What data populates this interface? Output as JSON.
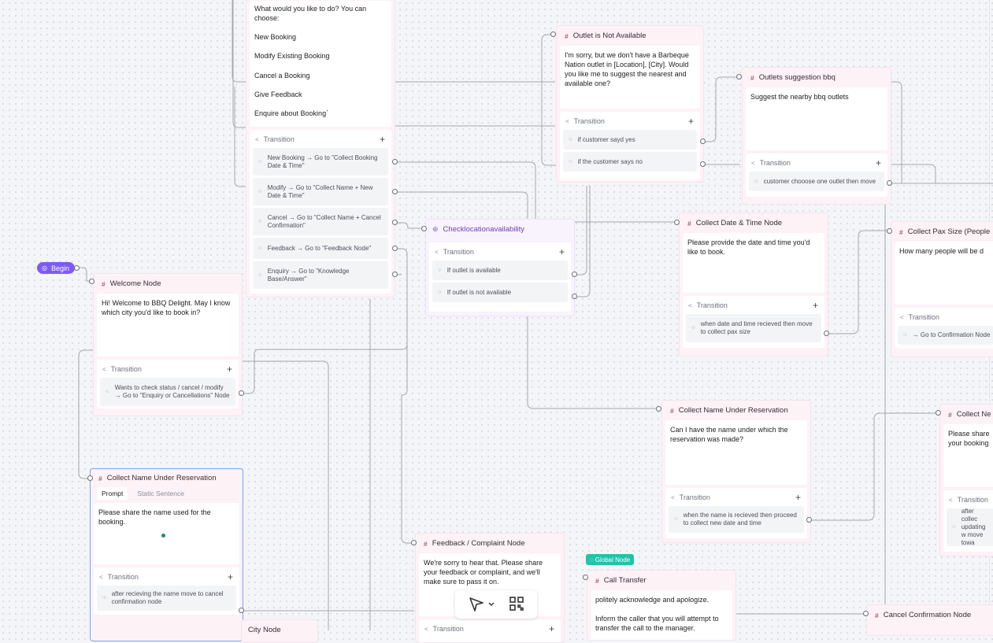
{
  "begin": {
    "label": "Begin"
  },
  "global_badge": "Global Node",
  "nodes": {
    "top_options": {
      "prompt": [
        "What would you like to do? You can choose:",
        "New Booking",
        "Modify Existing Booking",
        "Cancel a Booking",
        "Give Feedback",
        "Enquire about Booking`"
      ],
      "transition_label": "Transition",
      "transitions": [
        "New Booking → Go to \"Collect Booking Date & Time\"",
        "Modify → Go to \"Collect Name + New Date & Time\"",
        "Cancel → Go to \"Collect Name + Cancel Confirmation\"",
        "Feedback → Go to \"Feedback Node\"",
        "Enquiry → Go to \"Knowledge Base/Answer\""
      ]
    },
    "welcome": {
      "title": "Welcome Node",
      "prompt": "Hi! Welcome to BBQ Delight. May I know which city you'd like to book in?",
      "transition_label": "Transition",
      "transitions": [
        "Wants to check status / cancel / modify → Go to \"Enquiry or Cancellations\" Node"
      ]
    },
    "collect_name_left": {
      "title": "Collect Name Under Reservation",
      "tabs": [
        "Prompt",
        "Static Sentence"
      ],
      "prompt": "Please share the name used for the booking.",
      "transition_label": "Transition",
      "transitions": [
        "after recieving the name move to cancel confirmation node"
      ]
    },
    "city_node": {
      "title": "City Node"
    },
    "outlet_na": {
      "title": "Outlet is Not Available",
      "prompt": "I'm sorry, but we don't have a Barbeque Nation outlet in [Location], [City]. Would you like me to suggest the nearest and available one?",
      "transition_label": "Transition",
      "transitions": [
        "if customer sayd yes",
        "if the customer says no"
      ]
    },
    "check_avail": {
      "title": "Checklocationavailability",
      "transition_label": "Transition",
      "transitions": [
        "If outlet is available",
        "If outlet is not available"
      ]
    },
    "outlets_sugg": {
      "title": "Outlets suggestion bbq",
      "prompt": "Suggest the nearby bbq outlets",
      "transition_label": "Transition",
      "transitions": [
        "customer chooose one outlet then move"
      ]
    },
    "collect_date": {
      "title": "Collect Date & Time Node",
      "prompt": "Please provide the date and time you'd like to book.",
      "transition_label": "Transition",
      "transitions": [
        "when date and time recieved then move to collect pax size"
      ]
    },
    "collect_pax": {
      "title": "Collect Pax Size (People",
      "prompt": "How many people will be d",
      "transition_label": "Transition",
      "transitions": [
        "→ Go to Confirmation Node"
      ]
    },
    "collect_name_mid": {
      "title": "Collect Name Under Reservation",
      "prompt": "Can I have the name under which the reservation was made?",
      "transition_label": "Transition",
      "transitions": [
        "when the name is recieved then proceed to collect new date and time"
      ]
    },
    "collect_new": {
      "title": "Collect Ne",
      "prompt": "Please share your booking",
      "transition_label": "Transition",
      "transitions": [
        "after collec updating w move towa"
      ]
    },
    "feedback": {
      "title": "Feedback / Complaint Node",
      "prompt": "We're sorry to hear that. Please share your feedback or complaint, and we'll make sure to pass it on.",
      "transition_label": "Transition"
    },
    "call_transfer": {
      "title": "Call Transfer",
      "prompt": [
        "politely acknowledge and apologize.",
        "Inform the caller that you will attempt to transfer the call to the manager."
      ]
    },
    "cancel_conf": {
      "title": "Cancel Confirmation Node"
    }
  },
  "colors": {
    "accent": "#7c5cf0",
    "global": "#22c3a8",
    "node_bg": "#fdf2f6",
    "selected_border": "#7aa3f5"
  }
}
